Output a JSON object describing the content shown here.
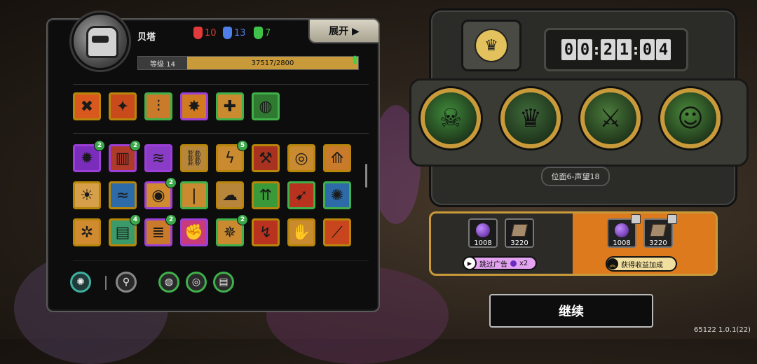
{
  "player": {
    "name": "贝塔",
    "tokens": [
      {
        "value": "10",
        "color": "#e23a3a"
      },
      {
        "value": "13",
        "color": "#4f7ee8"
      },
      {
        "value": "7",
        "color": "#3fc24a"
      }
    ],
    "level_label": "等级 14",
    "xp_text": "37517/2800",
    "xp_progress": 1.0
  },
  "panel": {
    "expand_label": "展开 ▶"
  },
  "equipped_skills": [
    {
      "icon": "cross-slash-icon",
      "glyph": "✖",
      "bg": "#d9581e",
      "border": "#b8860b"
    },
    {
      "icon": "claw-slash-icon",
      "glyph": "✦",
      "bg": "#c94a1a",
      "border": "#b8860b"
    },
    {
      "icon": "bamboo-icon",
      "glyph": "⫶",
      "bg": "#c97a2a",
      "border": "#3fb04a"
    },
    {
      "icon": "star-burst-icon",
      "glyph": "✸",
      "bg": "#d07b20",
      "border": "#9b3fd6"
    },
    {
      "icon": "totem-icon",
      "glyph": "✚",
      "bg": "#c98a30",
      "border": "#3fb04a"
    },
    {
      "icon": "green-orb-icon",
      "glyph": "◍",
      "bg": "#2f7a30",
      "border": "#3fb04a"
    }
  ],
  "skills": [
    {
      "icon": "purple-flame-icon",
      "glyph": "✹",
      "bg": "#7a2dbb",
      "border": "#9b3fd6",
      "badge": "2"
    },
    {
      "icon": "pillar-icon",
      "glyph": "▥",
      "bg": "#b03a2a",
      "border": "#9b3fd6",
      "badge": "2"
    },
    {
      "icon": "purple-drip-icon",
      "glyph": "≋",
      "bg": "#8b3cc7",
      "border": "#9b3fd6",
      "badge": ""
    },
    {
      "icon": "chain-icon",
      "glyph": "⛓",
      "bg": "#b8863b",
      "border": "#b8860b",
      "badge": ""
    },
    {
      "icon": "lightning-pillar-icon",
      "glyph": "ϟ",
      "bg": "#c98a30",
      "border": "#b8860b",
      "badge": "5"
    },
    {
      "icon": "axe-icon",
      "glyph": "⚒",
      "bg": "#a8321f",
      "border": "#b8860b",
      "badge": ""
    },
    {
      "icon": "spiral-icon",
      "glyph": "◎",
      "bg": "#c98a30",
      "border": "#b8860b",
      "badge": ""
    },
    {
      "icon": "spikes-icon",
      "glyph": "⟰",
      "bg": "#c97a2a",
      "border": "#b8860b",
      "badge": ""
    },
    {
      "icon": "sunrise-icon",
      "glyph": "☀",
      "bg": "#d6a04a",
      "border": "#b8860b",
      "badge": ""
    },
    {
      "icon": "shark-icon",
      "glyph": "≈",
      "bg": "#2d6aa8",
      "border": "#b8860b",
      "badge": ""
    },
    {
      "icon": "target-ring-icon",
      "glyph": "◉",
      "bg": "#d08a30",
      "border": "#9b3fd6",
      "badge": "2"
    },
    {
      "icon": "light-beam-icon",
      "glyph": "❘",
      "bg": "#c98a30",
      "border": "#3fb04a",
      "badge": ""
    },
    {
      "icon": "skull-cloud-icon",
      "glyph": "☁",
      "bg": "#b8863b",
      "border": "#b8860b",
      "badge": ""
    },
    {
      "icon": "arrow-rain-icon",
      "glyph": "⇈",
      "bg": "#3a9a3a",
      "border": "#b8860b",
      "badge": ""
    },
    {
      "icon": "red-arrow-icon",
      "glyph": "➹",
      "bg": "#b8321f",
      "border": "#3fb04a",
      "badge": ""
    },
    {
      "icon": "vortex-icon",
      "glyph": "✺",
      "bg": "#2d6aa8",
      "border": "#3fb04a",
      "badge": ""
    },
    {
      "icon": "gear-icon",
      "glyph": "✲",
      "bg": "#d08a30",
      "border": "#b8860b",
      "badge": ""
    },
    {
      "icon": "keyboard-icon",
      "glyph": "▤",
      "bg": "#3a9a6a",
      "border": "#b8860b",
      "badge": "4"
    },
    {
      "icon": "scroll-icon",
      "glyph": "≣",
      "bg": "#c97a2a",
      "border": "#9b3fd6",
      "badge": "2"
    },
    {
      "icon": "fist-icon",
      "glyph": "✊",
      "bg": "#c83a7a",
      "border": "#9b3fd6",
      "badge": ""
    },
    {
      "icon": "palm-burst-icon",
      "glyph": "✵",
      "bg": "#c98a30",
      "border": "#3fb04a",
      "badge": "2"
    },
    {
      "icon": "slash-arrows-icon",
      "glyph": "↯",
      "bg": "#b8321f",
      "border": "#b8860b",
      "badge": ""
    },
    {
      "icon": "claw-hand-icon",
      "glyph": "✋",
      "bg": "#c98a30",
      "border": "#b8860b",
      "badge": ""
    },
    {
      "icon": "flame-streak-icon",
      "glyph": "⟋",
      "bg": "#c9451e",
      "border": "#b8860b",
      "badge": ""
    }
  ],
  "filters": [
    {
      "icon": "all-filter-icon",
      "glyph": "✺",
      "ring": "#3fb0a0",
      "active": true
    },
    {
      "icon": "warrior-filter-icon",
      "glyph": "⚲",
      "ring": "#888888",
      "active": false
    },
    {
      "icon": "purple-filter-icon",
      "glyph": "◍",
      "ring": "#3fb04a",
      "active": false
    },
    {
      "icon": "grey-filter-icon",
      "glyph": "◎",
      "ring": "#3fb04a",
      "active": false
    },
    {
      "icon": "book-filter-icon",
      "glyph": "▤",
      "ring": "#3fb04a",
      "active": false
    }
  ],
  "timer": {
    "digits": [
      "0",
      "0",
      "2",
      "1",
      "0",
      "4"
    ]
  },
  "enemies": [
    {
      "icon": "beetle-enemy-icon",
      "glyph": "☠",
      "bg": "#3f8a3a"
    },
    {
      "icon": "demon-enemy-icon",
      "glyph": "♛",
      "bg": "#3f6a3a"
    },
    {
      "icon": "armored-enemy-icon",
      "glyph": "⚔",
      "bg": "#4a7a3a"
    },
    {
      "icon": "goggles-enemy-icon",
      "glyph": "☺",
      "bg": "#4a8a3a"
    }
  ],
  "stage_label": "位面6-声望18",
  "rewards": {
    "base": [
      {
        "icon": "purple-orb-icon",
        "value": "1008"
      },
      {
        "icon": "brick-icon",
        "value": "3220"
      }
    ],
    "boosted": [
      {
        "icon": "purple-orb-icon",
        "value": "1008"
      },
      {
        "icon": "brick-icon",
        "value": "3220"
      }
    ],
    "ad_label": "跳过广告",
    "ad_multiplier": "x2",
    "boost_label": "获得收益加成"
  },
  "continue_label": "继续",
  "version": "65122 1.0.1(22)",
  "colors": {
    "accent": "#c89a3a",
    "boost": "#de7a1e"
  }
}
